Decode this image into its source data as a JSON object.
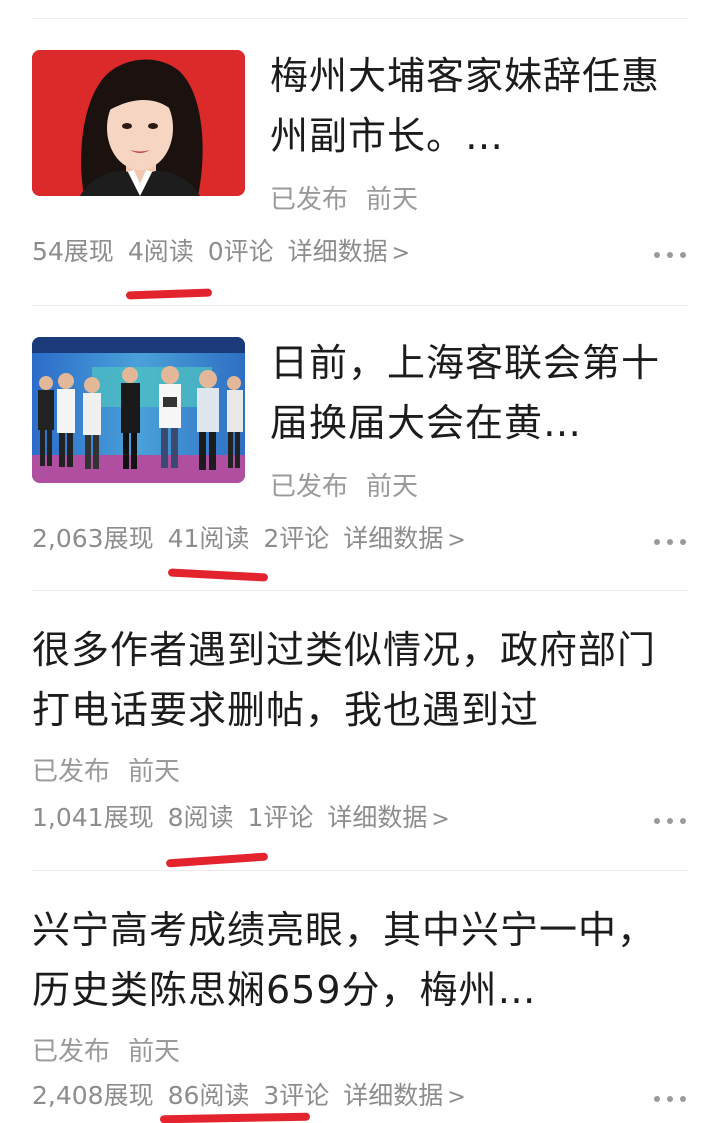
{
  "articles": [
    {
      "title": "梅州大埔客家妹辞任惠州副市长。…",
      "status": "已发布",
      "time": "前天",
      "impressions": "54展现",
      "reads": "4阅读",
      "comments": "0评论",
      "detail": "详细数据",
      "thumb_icon": "portrait-photo"
    },
    {
      "title": "日前，上海客联会第十届换届大会在黄…",
      "status": "已发布",
      "time": "前天",
      "impressions": "2,063展现",
      "reads": "41阅读",
      "comments": "2评论",
      "detail": "详细数据",
      "thumb_icon": "group-photo"
    },
    {
      "title": "很多作者遇到过类似情况，政府部门打电话要求删帖，我也遇到过",
      "status": "已发布",
      "time": "前天",
      "impressions": "1,041展现",
      "reads": "8阅读",
      "comments": "1评论",
      "detail": "详细数据"
    },
    {
      "title": "兴宁高考成绩亮眼，其中兴宁一中，历史类陈思娴659分，梅州…",
      "status": "已发布",
      "time": "前天",
      "impressions": "2,408展现",
      "reads": "86阅读",
      "comments": "3评论",
      "detail": "详细数据"
    }
  ],
  "colors": {
    "highlight": "#e3232d",
    "meta_text": "#9a9a9a",
    "title_text": "#1c1c1c"
  }
}
